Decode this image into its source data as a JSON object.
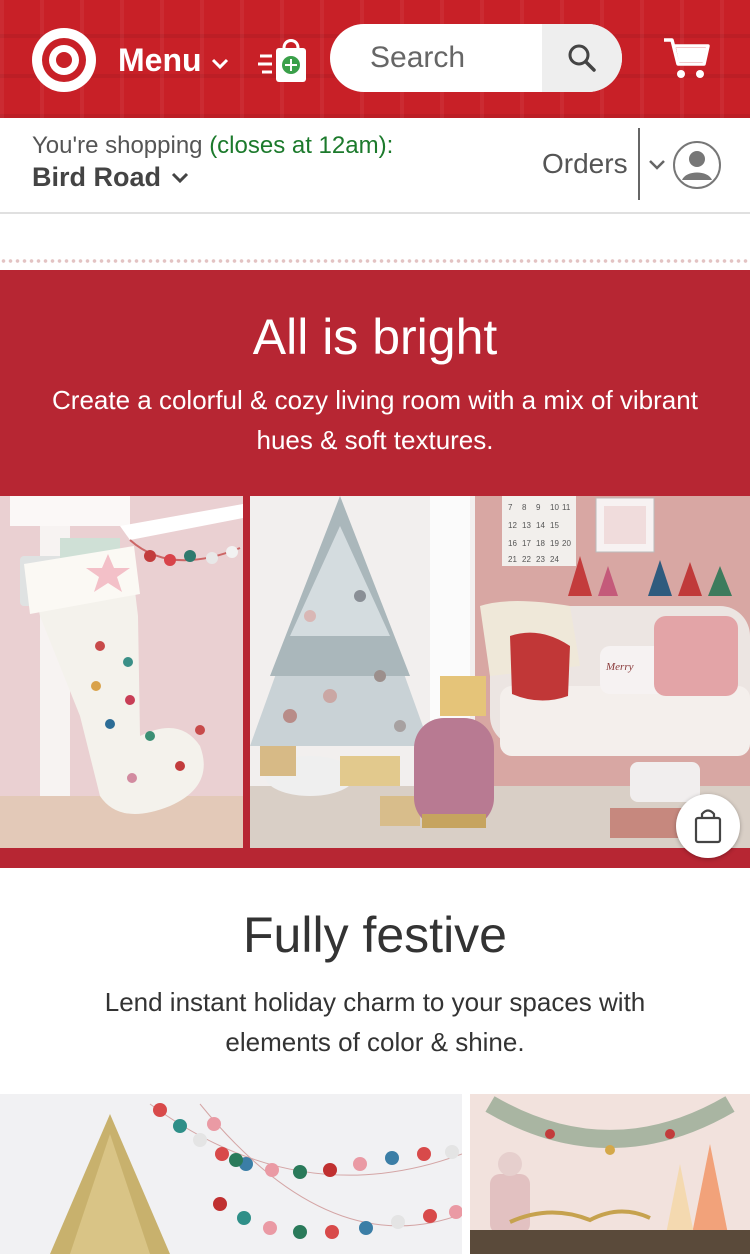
{
  "header": {
    "menu_label": "Menu",
    "search_placeholder": "Search",
    "icons": [
      "target-logo-icon",
      "drive-up-icon",
      "search-icon",
      "cart-icon"
    ],
    "brand_color": "#c82027"
  },
  "store": {
    "shopping_prefix": "You're shopping",
    "closes_text": "(closes at 12am):",
    "store_name": "Bird Road",
    "orders_label": "Orders",
    "closes_color": "#1c7a2c"
  },
  "hero": {
    "title": "All is bright",
    "subtitle": "Create a colorful & cozy living room with a mix of vibrant hues & soft textures.",
    "background": "#b72633"
  },
  "section2": {
    "title": "Fully festive",
    "subtitle": "Lend instant holiday charm to your spaces with elements of color & shine."
  },
  "calendar_numbers": [
    "7",
    "8",
    "9",
    "10",
    "11",
    "12",
    "13",
    "14",
    "15",
    "16",
    "17",
    "18",
    "19",
    "20",
    "21",
    "22",
    "23",
    "24"
  ],
  "pillow_text": "Merry"
}
